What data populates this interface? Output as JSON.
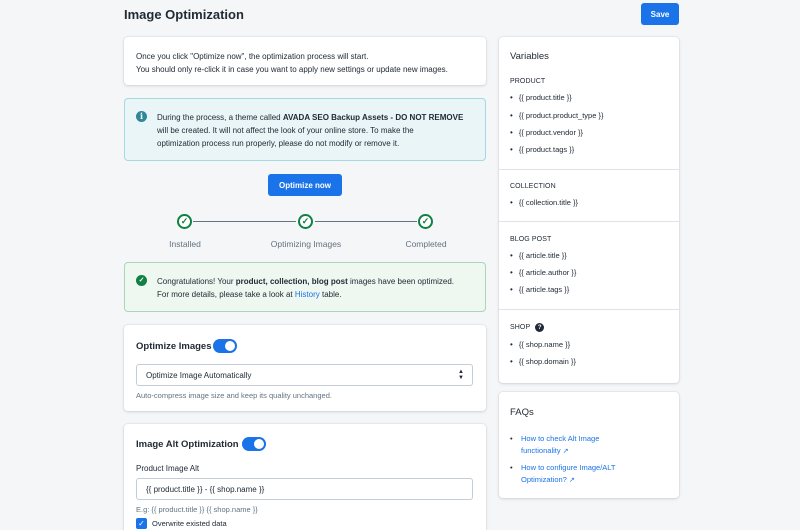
{
  "header": {
    "title": "Image Optimization",
    "save_label": "Save"
  },
  "intro": {
    "line1": "Once you click \"Optimize now\", the optimization process will start.",
    "line2": "You should only re-click it in case you want to apply new settings or update new images."
  },
  "info_banner": {
    "icon": "info-icon",
    "text_before": "During the process, a theme called ",
    "theme_name": "AVADA SEO Backup Assets - DO NOT REMOVE",
    "line2": "will be created. It will not affect the look of your online store. To make the",
    "line3": "optimization process run properly, please do not modify or remove it."
  },
  "optimize_now_label": "Optimize now",
  "steps": [
    {
      "label": "Installed",
      "done": true
    },
    {
      "label": "Optimizing Images",
      "done": true
    },
    {
      "label": "Completed",
      "done": true
    }
  ],
  "success_banner": {
    "icon": "check-circle-icon",
    "text_before": "Congratulations! Your ",
    "bold": "product, collection, blog post",
    "text_after": " images have been optimized.",
    "line2_before": "For more details, please take a look at ",
    "link": "History",
    "line2_after": " table."
  },
  "optimize_images": {
    "heading": "Optimize Images",
    "toggle_on": true,
    "select_value": "Optimize Image Automatically",
    "help": "Auto-compress image size and keep its quality unchanged."
  },
  "alt_optimization": {
    "heading": "Image Alt Optimization",
    "toggle_on": true,
    "field_label": "Product Image Alt",
    "field_value": "{{ product.title }} - {{ shop.name }}",
    "example": "E.g: {{ product.title }} {{ shop.name }}",
    "checkbox_label": "Overwrite existed data",
    "checkbox_checked": true
  },
  "variables": {
    "title": "Variables",
    "product": {
      "title": "PRODUCT",
      "items": [
        "{{ product.title }}",
        "{{ product.product_type }}",
        "{{ product.vendor }}",
        "{{ product.tags }}"
      ]
    },
    "collection": {
      "title": "COLLECTION",
      "items": [
        "{{ collection.title }}"
      ]
    },
    "blog": {
      "title": "BLOG POST",
      "items": [
        "{{ article.title }}",
        "{{ article.author }}",
        "{{ article.tags }}"
      ]
    },
    "shop": {
      "title": "SHOP",
      "icon": "question-circle-icon",
      "items": [
        "{{ shop.name }}",
        "{{ shop.domain }}"
      ]
    }
  },
  "faqs": {
    "title": "FAQs",
    "items": [
      {
        "line1": "How to check Alt Image",
        "line2": "functionality"
      },
      {
        "line1": "How to configure Image/ALT",
        "line2": "Optimization?"
      }
    ]
  },
  "colors": {
    "primary": "#1a73e8",
    "success": "#108043",
    "info_bg": "#eaf5f7",
    "success_bg": "#eff7f1"
  }
}
